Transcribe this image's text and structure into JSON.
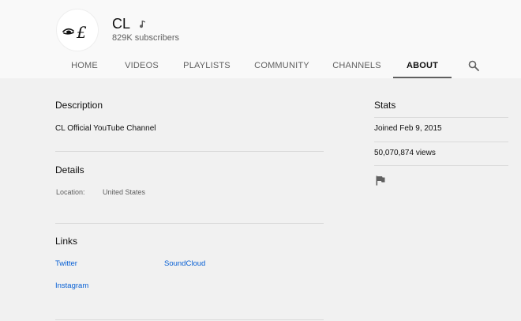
{
  "channel": {
    "name": "CL",
    "subscribers": "829K subscribers",
    "avatar_icon": "cl-logo-avatar",
    "verified_icon": "music-note-icon"
  },
  "tabs": [
    {
      "label": "HOME"
    },
    {
      "label": "VIDEOS"
    },
    {
      "label": "PLAYLISTS"
    },
    {
      "label": "COMMUNITY"
    },
    {
      "label": "CHANNELS"
    },
    {
      "label": "ABOUT",
      "active": true
    }
  ],
  "search_icon": "search-icon",
  "about": {
    "description_title": "Description",
    "description_text": "CL Official YouTube Channel",
    "details_title": "Details",
    "location_label": "Location:",
    "location_value": "United States",
    "links_title": "Links",
    "links": [
      {
        "label": "Twitter"
      },
      {
        "label": "SoundCloud"
      },
      {
        "label": "Instagram"
      }
    ]
  },
  "stats": {
    "title": "Stats",
    "joined": "Joined Feb 9, 2015",
    "views": "50,070,874 views",
    "report_icon": "flag-icon"
  },
  "colors": {
    "header_bg": "#f9f9f9",
    "page_bg": "#f1f1f1",
    "link": "#065fd4",
    "secondary_text": "#606060"
  }
}
